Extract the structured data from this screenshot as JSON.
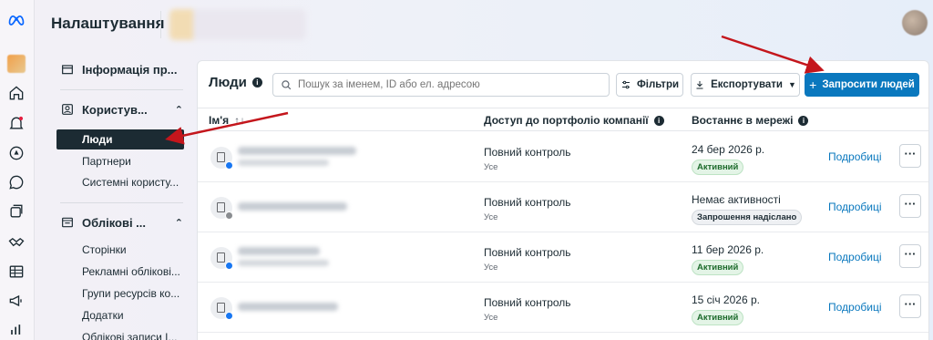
{
  "header": {
    "title": "Налаштування"
  },
  "rail": {
    "icons": [
      "meta-logo-icon",
      "business-avatar-icon",
      "home-icon",
      "notifications-icon",
      "compass-icon",
      "chat-icon",
      "pages-icon",
      "handshake-icon",
      "table-icon",
      "megaphone-icon",
      "analytics-icon"
    ]
  },
  "sidebar": {
    "business_info": "Інформація пр...",
    "users_section": "Користув...",
    "users_items": [
      "Люди",
      "Партнери",
      "Системні користу..."
    ],
    "accounts_section": "Облікові ...",
    "accounts_items": [
      "Сторінки",
      "Рекламні облікові...",
      "Групи ресурсів ко...",
      "Додатки",
      "Облікові записи І..."
    ]
  },
  "main": {
    "title": "Люди",
    "search_placeholder": "Пошук за іменем, ID або ел. адресою",
    "filters_label": "Фільтри",
    "export_label": "Експортувати",
    "invite_label": "Запросити людей",
    "columns": {
      "name": "Ім'я",
      "sort_glyph": "↑↓",
      "access": "Доступ до портфоліо компанії",
      "last_online": "Востаннє в мережі"
    },
    "rows": [
      {
        "access": "Повний контроль",
        "access_sub": "Усе",
        "last": "24 бер 2026 р.",
        "status": "Активний",
        "status_type": "green",
        "details": "Подробиці"
      },
      {
        "access": "Повний контроль",
        "access_sub": "Усе",
        "last": "Немає активності",
        "status": "Запрошення надіслано",
        "status_type": "grey",
        "details": "Подробиці"
      },
      {
        "access": "Повний контроль",
        "access_sub": "Усе",
        "last": "11 бер 2026 р.",
        "status": "Активний",
        "status_type": "green",
        "details": "Подробиці"
      },
      {
        "access": "Повний контроль",
        "access_sub": "Усе",
        "last": "15 січ 2026 р.",
        "status": "Активний",
        "status_type": "green",
        "details": "Подробиці"
      }
    ],
    "more_glyph": "···"
  },
  "colors": {
    "accent": "#0a78be",
    "annotation": "#c4161c",
    "active_nav": "#1c2b33"
  }
}
